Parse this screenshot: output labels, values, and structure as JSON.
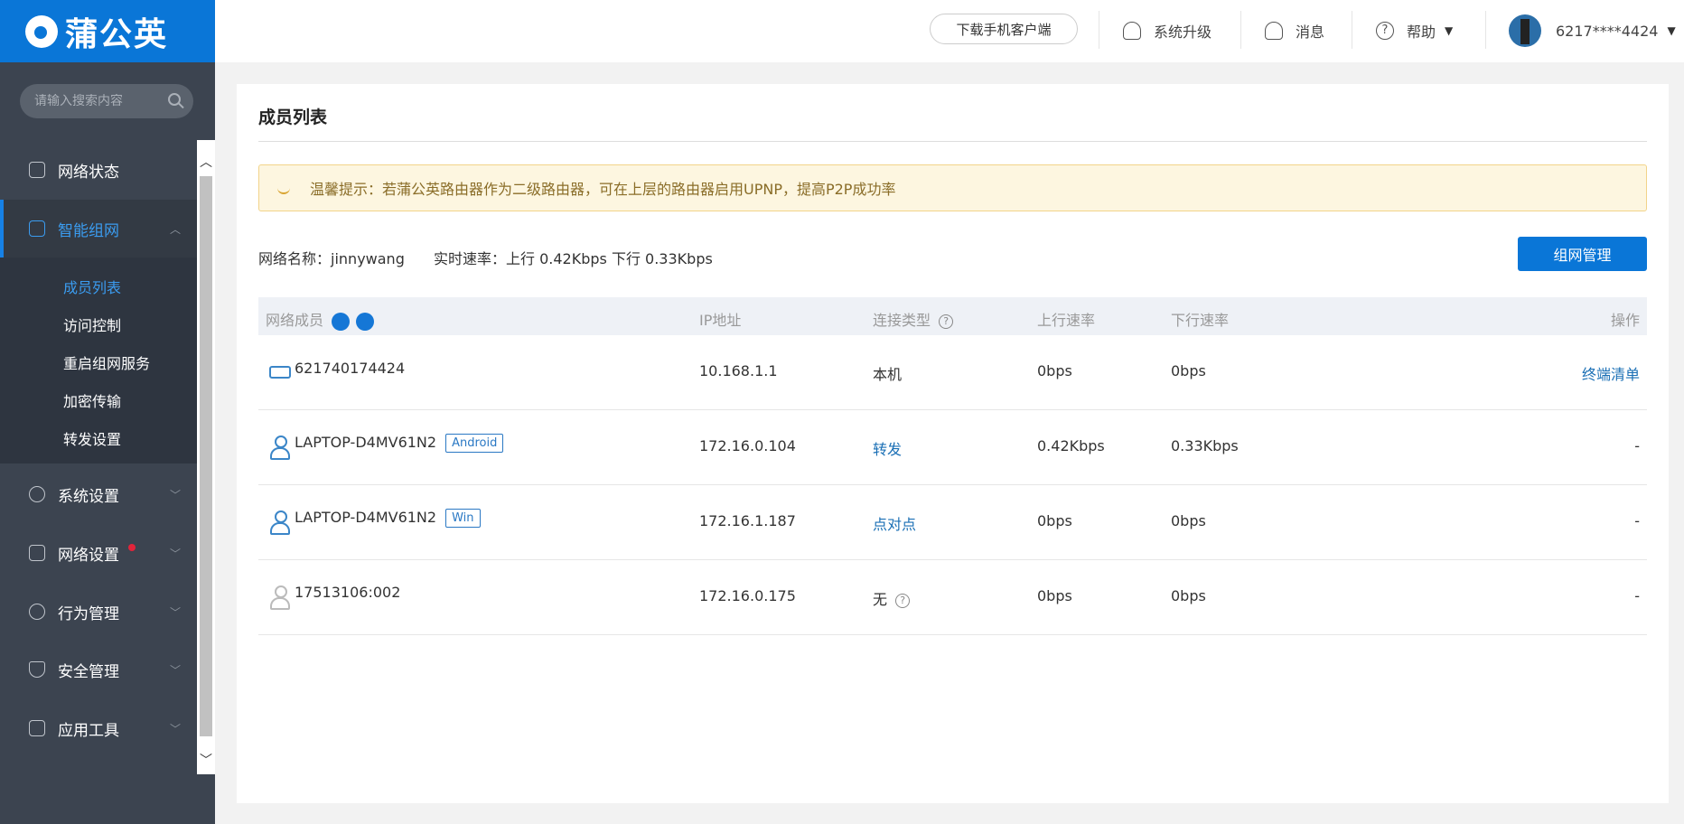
{
  "app": {
    "logo_text": "蒲公英"
  },
  "sidebar": {
    "search_placeholder": "请输入搜索内容",
    "items": [
      {
        "label": "网络状态",
        "icon": "network-status-icon"
      },
      {
        "label": "智能组网",
        "icon": "smart-network-icon",
        "active": true
      },
      {
        "label": "系统设置",
        "icon": "gear-icon"
      },
      {
        "label": "网络设置",
        "icon": "network-settings-icon",
        "has_notification": true
      },
      {
        "label": "行为管理",
        "icon": "behavior-icon"
      },
      {
        "label": "安全管理",
        "icon": "shield-icon"
      },
      {
        "label": "应用工具",
        "icon": "toolbox-icon"
      }
    ],
    "submenu": [
      "成员列表",
      "访问控制",
      "重启组网服务",
      "加密传输",
      "转发设置"
    ]
  },
  "topbar": {
    "download_label": "下载手机客户端",
    "upgrade_label": "系统升级",
    "messages_label": "消息",
    "help_label": "帮助",
    "account_label": "6217****4424"
  },
  "main": {
    "title": "成员列表",
    "notice": "温馨提示：若蒲公英路由器作为二级路由器，可在上层的路由器启用UPNP，提高P2P成功率",
    "network_name_label": "网络名称：",
    "network_name": "jinnywang",
    "speed_label": "实时速率：",
    "speed_value": "上行 0.42Kbps 下行 0.33Kbps",
    "manage_button": "组网管理",
    "columns": {
      "member": "网络成员",
      "ip": "IP地址",
      "conn_type": "连接类型",
      "up": "上行速率",
      "down": "下行速率",
      "action": "操作"
    },
    "rows": [
      {
        "name": "621740174424",
        "tag": "",
        "ip": "10.168.1.1",
        "conn": "本机",
        "up": "0bps",
        "down": "0bps",
        "action": "终端清单",
        "icon": "router-icon"
      },
      {
        "name": "LAPTOP-D4MV61N2",
        "tag": "Android",
        "ip": "172.16.0.104",
        "conn": "转发",
        "up": "0.42Kbps",
        "down": "0.33Kbps",
        "action": "-",
        "icon": "user-icon"
      },
      {
        "name": "LAPTOP-D4MV61N2",
        "tag": "Win",
        "ip": "172.16.1.187",
        "conn": "点对点",
        "up": "0bps",
        "down": "0bps",
        "action": "-",
        "icon": "user-icon"
      },
      {
        "name": "17513106:002",
        "tag": "",
        "ip": "172.16.0.175",
        "conn": "无",
        "up": "0bps",
        "down": "0bps",
        "action": "-",
        "icon": "offline-user-icon"
      }
    ]
  }
}
